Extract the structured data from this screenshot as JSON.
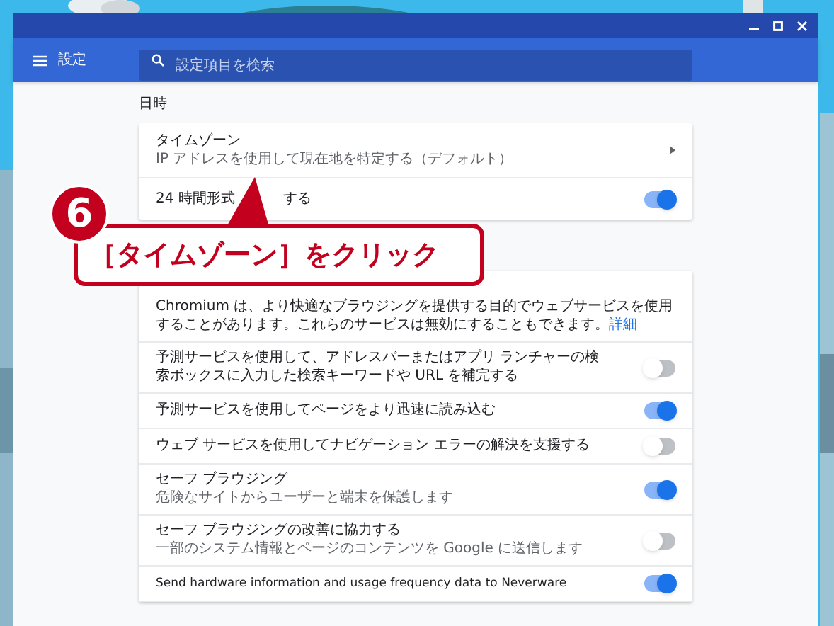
{
  "toolbar": {
    "title": "設定",
    "search": {
      "placeholder": "設定項目を検索"
    }
  },
  "section": {
    "heading": "日時"
  },
  "datetime_rows": [
    {
      "kind": "link",
      "title": "タイムゾーン",
      "subtitle": "IP アドレスを使用して現在地を特定する（デフォルト）"
    },
    {
      "kind": "toggle",
      "title_parts": [
        "24 時間形式",
        "する"
      ],
      "on": true
    }
  ],
  "callout": {
    "step": "6",
    "text": "［タイムゾーン］をクリック"
  },
  "privacy_rows": [
    {
      "kind": "note",
      "text": "Chromium は、より快適なブラウジングを提供する目的でウェブサービスを使用することがあります。これらのサービスは無効にすることもできます。",
      "link": "詳細"
    },
    {
      "kind": "toggle",
      "title": "予測サービスを使用して、アドレスバーまたはアプリ ランチャーの検索ボックスに入力した検索キーワードや URL を補完する",
      "on": false
    },
    {
      "kind": "toggle",
      "title": "予測サービスを使用してページをより迅速に読み込む",
      "on": true
    },
    {
      "kind": "toggle",
      "title": "ウェブ サービスを使用してナビゲーション エラーの解決を支援する",
      "on": false
    },
    {
      "kind": "toggle",
      "title": "セーフ ブラウジング",
      "subtitle": "危険なサイトからユーザーと端末を保護します",
      "on": true
    },
    {
      "kind": "toggle",
      "title": "セーフ ブラウジングの改善に協力する",
      "subtitle": "一部のシステム情報とページのコンテンツを Google に送信します",
      "on": false
    },
    {
      "kind": "toggle",
      "title": "Send hardware information and usage frequency data to Neverware",
      "on": true
    }
  ]
}
